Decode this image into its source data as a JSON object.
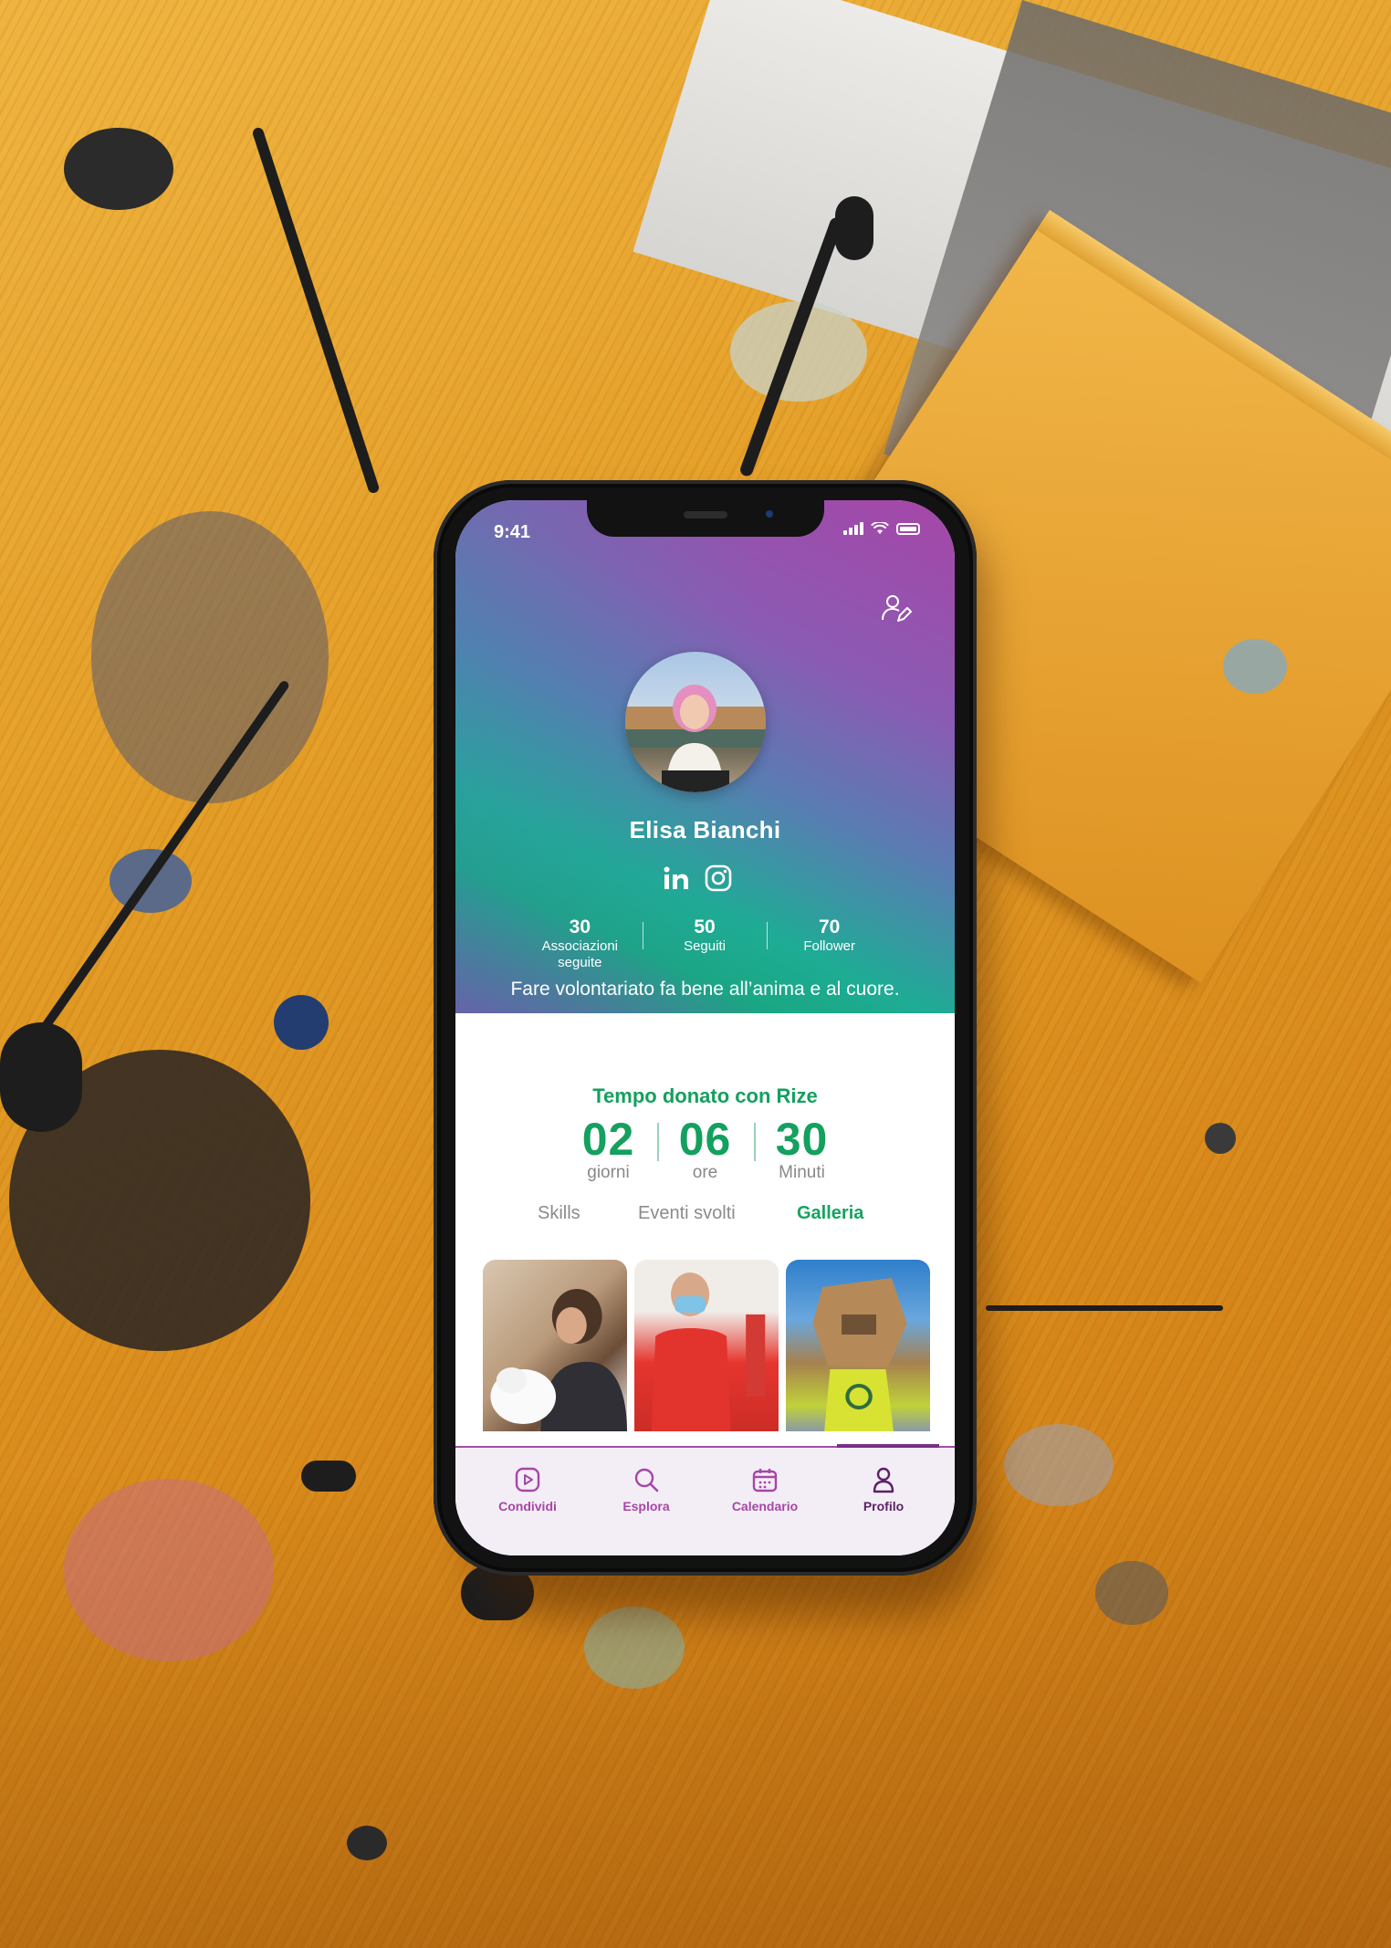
{
  "status_bar": {
    "time": "9:41"
  },
  "profile": {
    "name": "Elisa Bianchi",
    "socials": [
      "linkedin-icon",
      "instagram-icon"
    ],
    "stats": [
      {
        "value": "30",
        "label": "Associazioni seguite"
      },
      {
        "value": "50",
        "label": "Seguiti"
      },
      {
        "value": "70",
        "label": "Follower"
      }
    ],
    "bio": "Fare volontariato fa bene all’anima e al cuore."
  },
  "donated": {
    "title": "Tempo donato con Rize",
    "units": [
      {
        "value": "02",
        "label": "giorni"
      },
      {
        "value": "06",
        "label": "ore"
      },
      {
        "value": "30",
        "label": "Minuti"
      }
    ]
  },
  "tabs": {
    "items": [
      "Skills",
      "Eventi svolti",
      "Galleria"
    ],
    "active": "Galleria"
  },
  "gallery": {
    "photos": [
      "dog-photo",
      "volunteer-photo",
      "box-costume-photo"
    ]
  },
  "nav": {
    "items": [
      {
        "label": "Condividi",
        "icon": "play-square-icon"
      },
      {
        "label": "Esplora",
        "icon": "search-icon"
      },
      {
        "label": "Calendario",
        "icon": "calendar-icon"
      },
      {
        "label": "Profilo",
        "icon": "user-icon"
      }
    ],
    "active": "Profilo"
  },
  "colors": {
    "accent_green": "#14a05f",
    "accent_purple": "#a746a6",
    "nav_active": "#5c2167"
  }
}
